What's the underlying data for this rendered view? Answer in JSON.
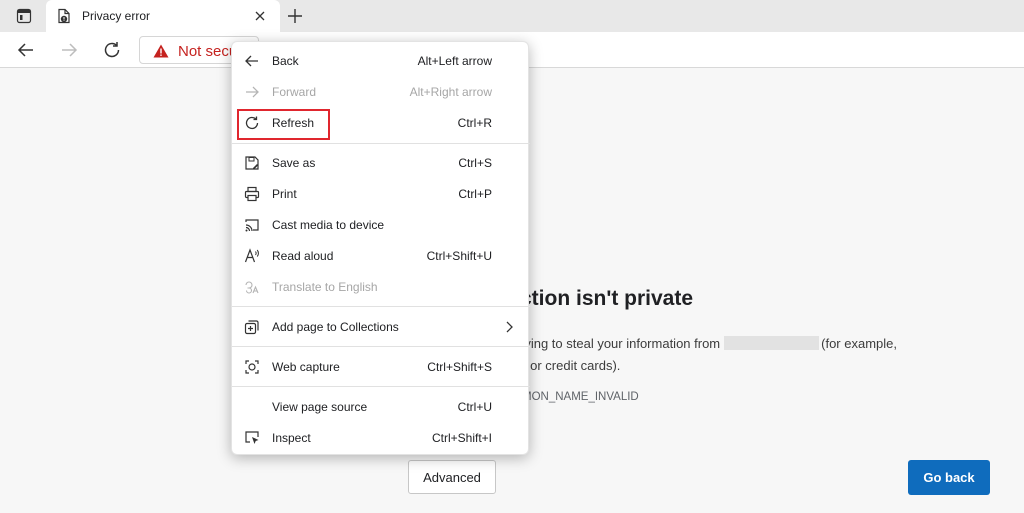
{
  "tab": {
    "title": "Privacy error"
  },
  "address": {
    "security_label": "Not secure"
  },
  "page": {
    "title": "ction isn't private",
    "line1_prefix": "rying to steal your information from",
    "line1_suffix": "(for example,",
    "line2": "s or credit cards).",
    "error_code": "MON_NAME_INVALID",
    "advanced_label": "Advanced",
    "go_back_label": "Go back"
  },
  "menu": {
    "items": [
      {
        "label": "Back",
        "shortcut": "Alt+Left arrow",
        "icon": "back-arrow-icon",
        "disabled": false
      },
      {
        "label": "Forward",
        "shortcut": "Alt+Right arrow",
        "icon": "forward-arrow-icon",
        "disabled": true
      },
      {
        "label": "Refresh",
        "shortcut": "Ctrl+R",
        "icon": "refresh-icon",
        "disabled": false
      },
      {
        "label": "Save as",
        "shortcut": "Ctrl+S",
        "icon": "save-as-icon",
        "disabled": false
      },
      {
        "label": "Print",
        "shortcut": "Ctrl+P",
        "icon": "print-icon",
        "disabled": false
      },
      {
        "label": "Cast media to device",
        "shortcut": "",
        "icon": "cast-icon",
        "disabled": false
      },
      {
        "label": "Read aloud",
        "shortcut": "Ctrl+Shift+U",
        "icon": "read-aloud-icon",
        "disabled": false
      },
      {
        "label": "Translate to English",
        "shortcut": "",
        "icon": "translate-icon",
        "disabled": true
      },
      {
        "label": "Add page to Collections",
        "shortcut": "",
        "icon": "collections-icon",
        "disabled": false
      },
      {
        "label": "Web capture",
        "shortcut": "Ctrl+Shift+S",
        "icon": "web-capture-icon",
        "disabled": false
      },
      {
        "label": "View page source",
        "shortcut": "Ctrl+U",
        "icon": "",
        "disabled": false
      },
      {
        "label": "Inspect",
        "shortcut": "Ctrl+Shift+I",
        "icon": "inspect-icon",
        "disabled": false
      }
    ],
    "highlighted": "Refresh"
  },
  "colors": {
    "warning_red": "#c5221f",
    "highlight_box": "#e0262e",
    "primary_button": "#0f6cbd"
  }
}
